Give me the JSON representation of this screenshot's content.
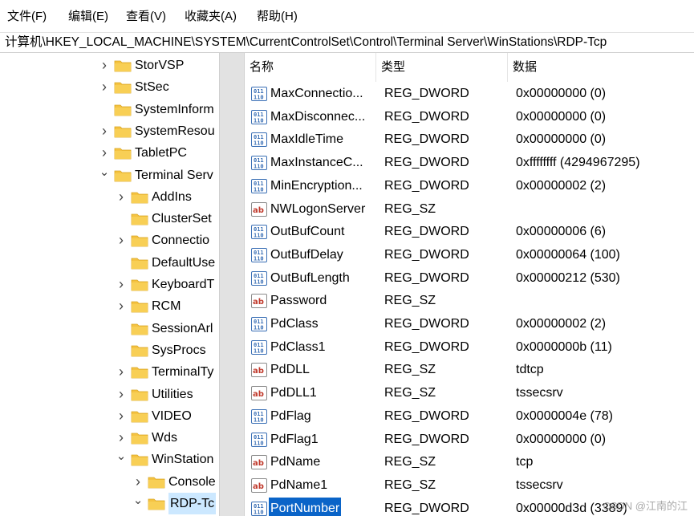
{
  "menu": [
    "文件(F)",
    "编辑(E)",
    "查看(V)",
    "收藏夹(A)",
    "帮助(H)"
  ],
  "address": "计算机\\HKEY_LOCAL_MACHINE\\SYSTEM\\CurrentControlSet\\Control\\Terminal Server\\WinStations\\RDP-Tcp",
  "tree": [
    {
      "label": "StorVSP",
      "level": 0,
      "expand": "collapsed"
    },
    {
      "label": "StSec",
      "level": 0,
      "expand": "collapsed"
    },
    {
      "label": "SystemInform",
      "level": 0,
      "expand": "none"
    },
    {
      "label": "SystemResou",
      "level": 0,
      "expand": "collapsed"
    },
    {
      "label": "TabletPC",
      "level": 0,
      "expand": "collapsed"
    },
    {
      "label": "Terminal Serv",
      "level": 0,
      "expand": "expanded"
    },
    {
      "label": "AddIns",
      "level": 1,
      "expand": "collapsed"
    },
    {
      "label": "ClusterSet",
      "level": 1,
      "expand": "none"
    },
    {
      "label": "Connectio",
      "level": 1,
      "expand": "collapsed"
    },
    {
      "label": "DefaultUse",
      "level": 1,
      "expand": "none"
    },
    {
      "label": "KeyboardT",
      "level": 1,
      "expand": "collapsed"
    },
    {
      "label": "RCM",
      "level": 1,
      "expand": "collapsed"
    },
    {
      "label": "SessionArl",
      "level": 1,
      "expand": "none"
    },
    {
      "label": "SysProcs",
      "level": 1,
      "expand": "none"
    },
    {
      "label": "TerminalTy",
      "level": 1,
      "expand": "collapsed"
    },
    {
      "label": "Utilities",
      "level": 1,
      "expand": "collapsed"
    },
    {
      "label": "VIDEO",
      "level": 1,
      "expand": "collapsed"
    },
    {
      "label": "Wds",
      "level": 1,
      "expand": "collapsed"
    },
    {
      "label": "WinStation",
      "level": 1,
      "expand": "expanded"
    },
    {
      "label": "Console",
      "level": 2,
      "expand": "collapsed"
    },
    {
      "label": "RDP-Tc",
      "level": 2,
      "expand": "expanded",
      "selected": true
    }
  ],
  "columns": {
    "name": "名称",
    "type": "类型",
    "data": "数据"
  },
  "values": [
    {
      "icon": "dword",
      "name": "MaxConnectio...",
      "type": "REG_DWORD",
      "data": "0x00000000 (0)"
    },
    {
      "icon": "dword",
      "name": "MaxDisconnec...",
      "type": "REG_DWORD",
      "data": "0x00000000 (0)"
    },
    {
      "icon": "dword",
      "name": "MaxIdleTime",
      "type": "REG_DWORD",
      "data": "0x00000000 (0)"
    },
    {
      "icon": "dword",
      "name": "MaxInstanceC...",
      "type": "REG_DWORD",
      "data": "0xffffffff (4294967295)"
    },
    {
      "icon": "dword",
      "name": "MinEncryption...",
      "type": "REG_DWORD",
      "data": "0x00000002 (2)"
    },
    {
      "icon": "sz",
      "name": "NWLogonServer",
      "type": "REG_SZ",
      "data": ""
    },
    {
      "icon": "dword",
      "name": "OutBufCount",
      "type": "REG_DWORD",
      "data": "0x00000006 (6)"
    },
    {
      "icon": "dword",
      "name": "OutBufDelay",
      "type": "REG_DWORD",
      "data": "0x00000064 (100)"
    },
    {
      "icon": "dword",
      "name": "OutBufLength",
      "type": "REG_DWORD",
      "data": "0x00000212 (530)"
    },
    {
      "icon": "sz",
      "name": "Password",
      "type": "REG_SZ",
      "data": ""
    },
    {
      "icon": "dword",
      "name": "PdClass",
      "type": "REG_DWORD",
      "data": "0x00000002 (2)"
    },
    {
      "icon": "dword",
      "name": "PdClass1",
      "type": "REG_DWORD",
      "data": "0x0000000b (11)"
    },
    {
      "icon": "sz",
      "name": "PdDLL",
      "type": "REG_SZ",
      "data": "tdtcp"
    },
    {
      "icon": "sz",
      "name": "PdDLL1",
      "type": "REG_SZ",
      "data": "tssecsrv"
    },
    {
      "icon": "dword",
      "name": "PdFlag",
      "type": "REG_DWORD",
      "data": "0x0000004e (78)"
    },
    {
      "icon": "dword",
      "name": "PdFlag1",
      "type": "REG_DWORD",
      "data": "0x00000000 (0)"
    },
    {
      "icon": "sz",
      "name": "PdName",
      "type": "REG_SZ",
      "data": "tcp"
    },
    {
      "icon": "sz",
      "name": "PdName1",
      "type": "REG_SZ",
      "data": "tssecsrv"
    },
    {
      "icon": "dword",
      "name": "PortNumber",
      "type": "REG_DWORD",
      "data": "0x00000d3d (3389)",
      "selected": true
    }
  ],
  "watermark": "CSDN @江南的江",
  "colors": {
    "selection": "#0a64c8",
    "tree_selection": "#cce8ff",
    "folder": "#f5c342",
    "dword_icon": "#3a6fb5",
    "sz_icon": "#c0392b"
  }
}
